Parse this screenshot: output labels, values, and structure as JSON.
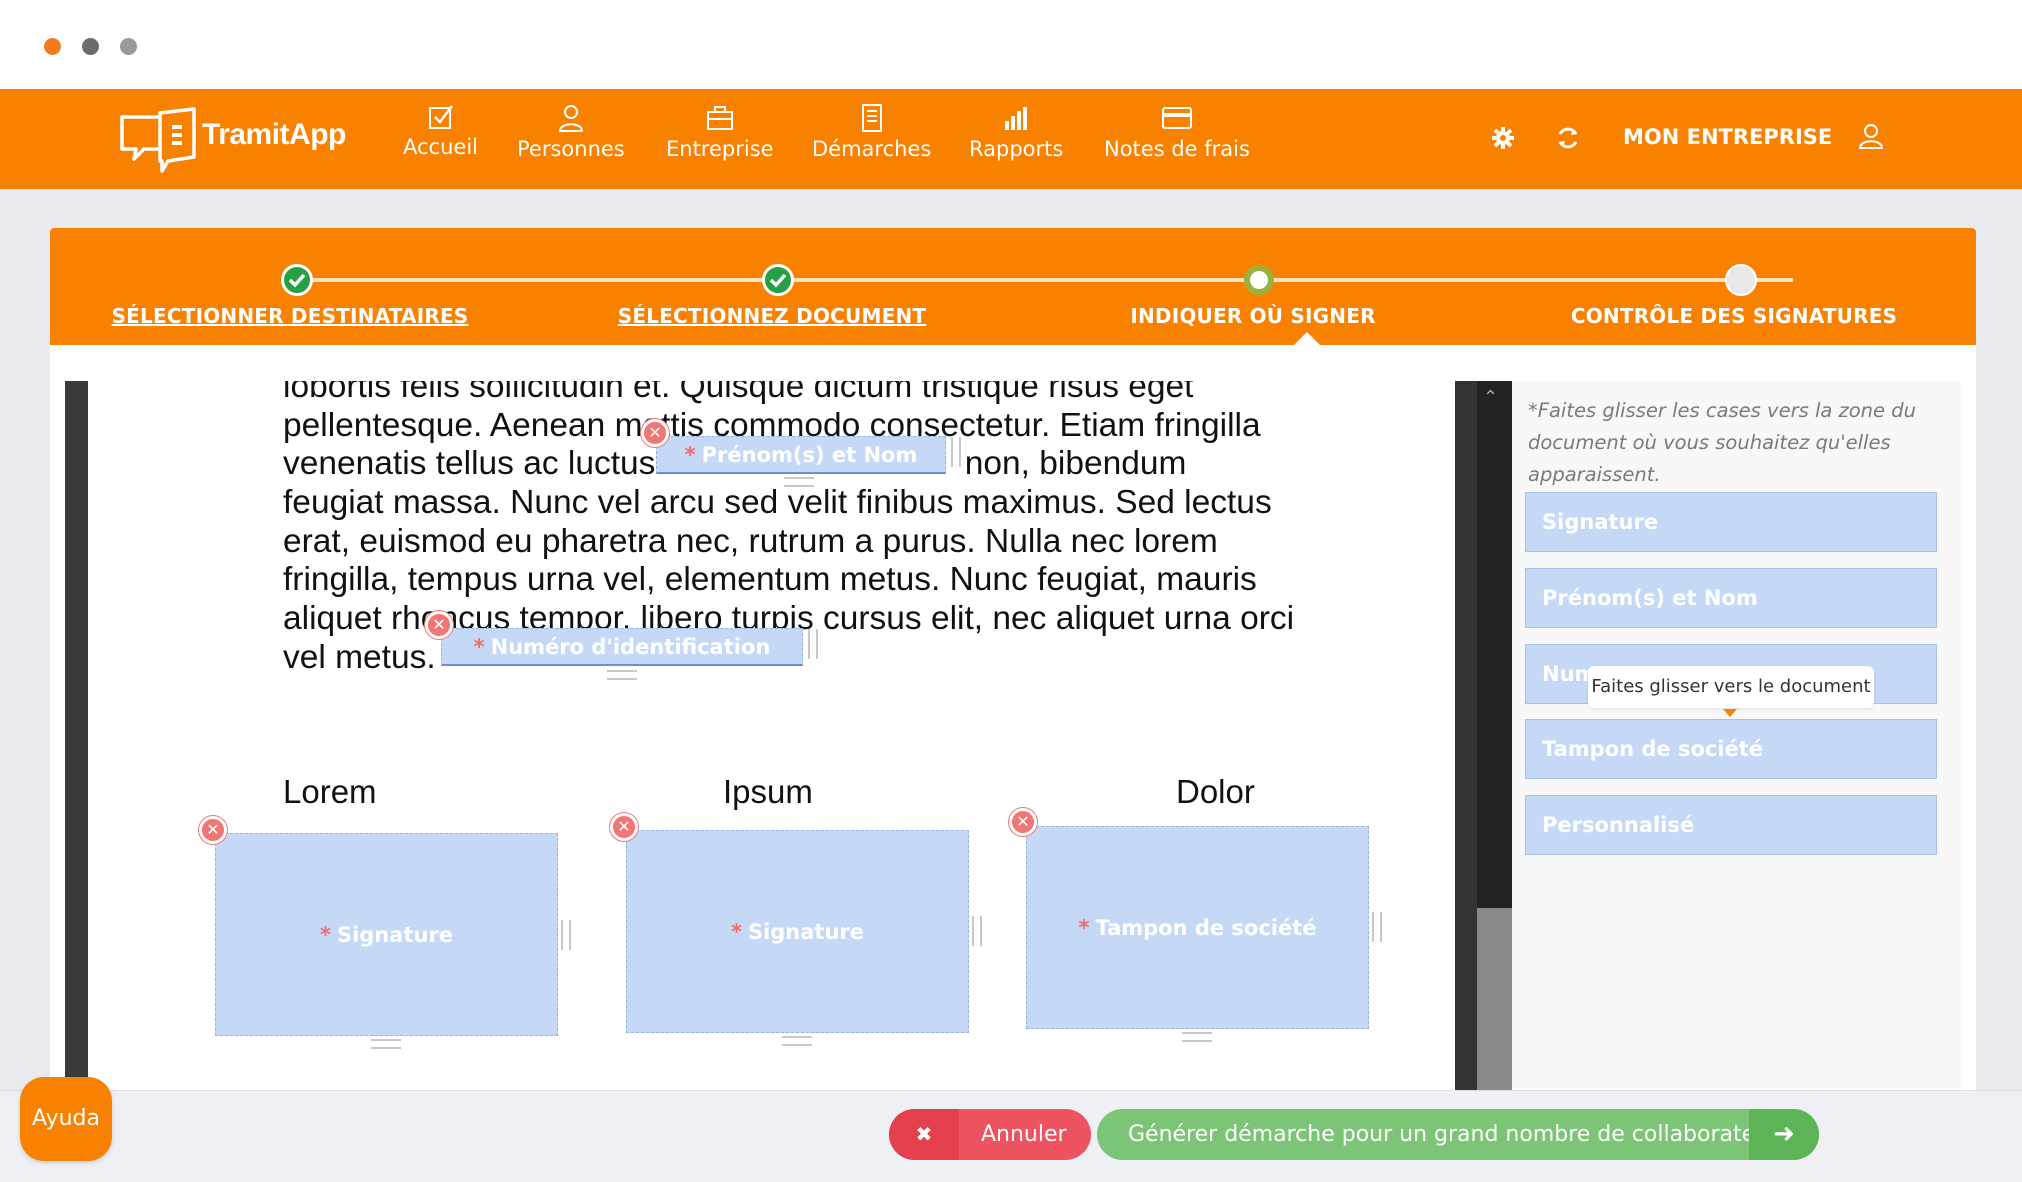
{
  "app": {
    "logo_text": "TramitApp"
  },
  "nav": {
    "items": [
      {
        "label": "Accueil",
        "icon": "checkbox-icon"
      },
      {
        "label": "Personnes",
        "icon": "person-icon"
      },
      {
        "label": "Entreprise",
        "icon": "briefcase-icon"
      },
      {
        "label": "Démarches",
        "icon": "document-icon"
      },
      {
        "label": "Rapports",
        "icon": "bar-chart-icon"
      },
      {
        "label": "Notes de frais",
        "icon": "credit-card-icon"
      }
    ],
    "company_label": "MON ENTREPRISE"
  },
  "steps": [
    {
      "label": "SÉLECTIONNER DESTINATAIRES",
      "status": "done"
    },
    {
      "label": "SÉLECTIONNEZ DOCUMENT",
      "status": "done"
    },
    {
      "label": "INDIQUER OÙ SIGNER",
      "status": "current"
    },
    {
      "label": "CONTRÔLE DES SIGNATURES",
      "status": "todo"
    }
  ],
  "document": {
    "lines": [
      "lobortis felis sollicitudin et. Quisque dictum tristique risus eget",
      "pellentesque. Aenean mattis commodo consectetur. Etiam fringilla",
      "venenatis tellus ac luctus.",
      "feugiat massa. Nunc vel arcu sed velit finibus maximus. Sed lectus",
      "erat, euismod eu pharetra nec, rutrum a purus. Nulla nec lorem",
      "fringilla, tempus urna vel, elementum metus. Nunc feugiat, mauris",
      "aliquet rhoncus tempor, libero turpis cursus elit, nec aliquet urna orci",
      "vel metus."
    ],
    "line3_tail": "non, bibendum",
    "columns": [
      "Lorem",
      "Ipsum",
      "Dolor"
    ],
    "placed_fields": {
      "name": "Prénom(s) et Nom",
      "id_number": "Numéro d'identification",
      "signature_1": "Signature",
      "signature_2": "Signature",
      "stamp": "Tampon de société"
    },
    "required_mark": "*"
  },
  "panel": {
    "hint": "*Faites glisser les cases vers la zone du document où vous souhaitez qu'elles apparaissent.",
    "items": [
      "Signature",
      "Prénom(s) et Nom",
      "Num",
      "Tampon de société",
      "Personnalisé"
    ],
    "tooltip": "Faites glisser vers le document"
  },
  "footer": {
    "help_label": "Ayuda",
    "cancel_label": "Annuler",
    "generate_label": "Générer démarche pour un grand nombre de collaborateurs"
  },
  "colors": {
    "brand_orange": "#f98100",
    "step_done_green": "#27a045",
    "field_blue": "#c5d9f7",
    "cancel_red": "#ed5360",
    "generate_green": "#7cc576"
  }
}
